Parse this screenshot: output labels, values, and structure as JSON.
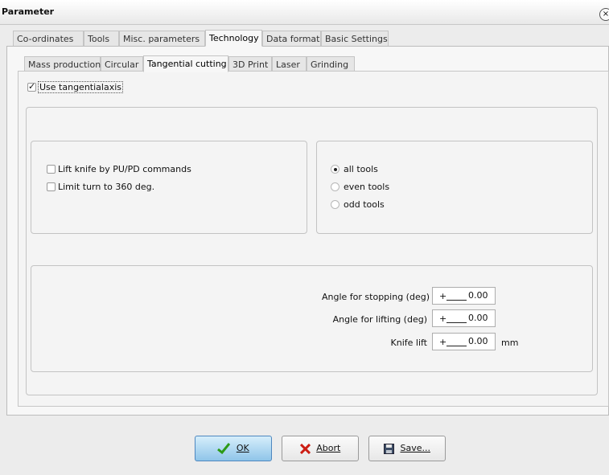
{
  "window": {
    "title": "Parameter",
    "close_glyph": "×"
  },
  "main_tabs": [
    {
      "label": "Co-ordinates"
    },
    {
      "label": "Tools"
    },
    {
      "label": "Misc. parameters"
    },
    {
      "label": "Technology"
    },
    {
      "label": "Data format"
    },
    {
      "label": "Basic Settings"
    }
  ],
  "main_active_tab": "Technology",
  "sub_tabs": [
    {
      "label": "Mass production"
    },
    {
      "label": "Circular"
    },
    {
      "label": "Tangential cutting"
    },
    {
      "label": "3D Print"
    },
    {
      "label": "Laser"
    },
    {
      "label": "Grinding"
    }
  ],
  "sub_active_tab": "Tangential cutting",
  "use_axis": {
    "label": "Use tangentialaxis",
    "checked": true
  },
  "left_options": [
    {
      "label": "Lift knife by PU/PD commands",
      "checked": false
    },
    {
      "label": "Limit turn to 360 deg.",
      "checked": false
    }
  ],
  "tool_radios": [
    {
      "label": "all tools",
      "checked": true
    },
    {
      "label": "even tools",
      "checked": false
    },
    {
      "label": "odd tools",
      "checked": false
    }
  ],
  "fields": [
    {
      "label": "Angle for stopping (deg)",
      "sign": "+",
      "value": "0.00",
      "unit": ""
    },
    {
      "label": "Angle for lifting (deg)",
      "sign": "+",
      "value": "0.00",
      "unit": ""
    },
    {
      "label": "Knife lift",
      "sign": "+",
      "value": "0.00",
      "unit": "mm"
    }
  ],
  "buttons": {
    "ok": {
      "label": "OK",
      "icon": "check-icon",
      "color": "#2c9a16"
    },
    "abort": {
      "label": "Abort",
      "icon": "x-icon",
      "color": "#cc1d13"
    },
    "save": {
      "label": "Save...",
      "icon": "floppy-disk-icon"
    }
  },
  "colors": {
    "ok_button_top": "#d6eefb",
    "ok_button_bottom": "#8fc5e9"
  }
}
